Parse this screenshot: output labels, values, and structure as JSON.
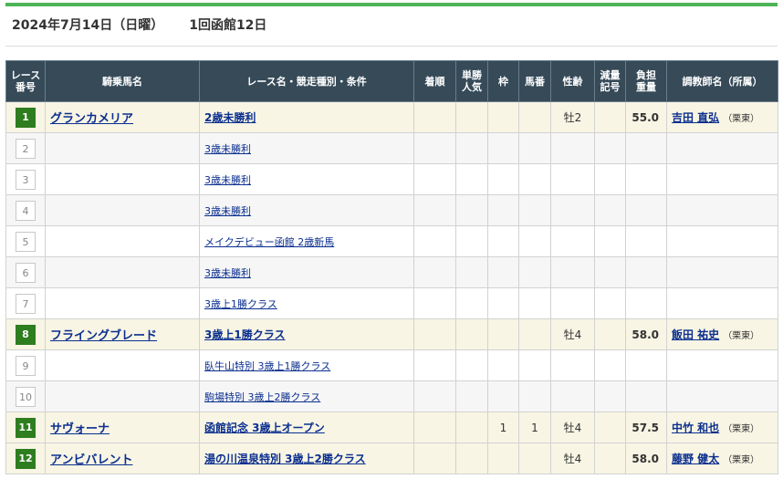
{
  "header": {
    "date": "2024年7月14日（日曜）",
    "meet": "1回函館12日"
  },
  "columns": [
    "レース番号",
    "騎乗馬名",
    "レース名・競走種別・条件",
    "着順",
    "単勝人気",
    "枠",
    "馬番",
    "性齢",
    "減量記号",
    "負担重量",
    "調教師名（所属）"
  ],
  "column_lines": [
    [
      "レース",
      "番号"
    ],
    [
      "騎乗馬名"
    ],
    [
      "レース名・競走種別・条件"
    ],
    [
      "着順"
    ],
    [
      "単勝",
      "人気"
    ],
    [
      "枠"
    ],
    [
      "馬番"
    ],
    [
      "性齢"
    ],
    [
      "減量",
      "記号"
    ],
    [
      "負担",
      "重量"
    ],
    [
      "調教師名（所属）"
    ]
  ],
  "rows": [
    {
      "no": "1",
      "horse": "グランカメリア",
      "race": "2歳未勝利",
      "finish": "",
      "pop": "",
      "waku": "",
      "umaban": "",
      "sexage": "牡2",
      "genryo": "",
      "weight": "55.0",
      "trainer": "吉田 直弘",
      "affil": "（栗東）",
      "ride": true
    },
    {
      "no": "2",
      "horse": "",
      "race": "3歳未勝利",
      "finish": "",
      "pop": "",
      "waku": "",
      "umaban": "",
      "sexage": "",
      "genryo": "",
      "weight": "",
      "trainer": "",
      "affil": "",
      "ride": false
    },
    {
      "no": "3",
      "horse": "",
      "race": "3歳未勝利",
      "finish": "",
      "pop": "",
      "waku": "",
      "umaban": "",
      "sexage": "",
      "genryo": "",
      "weight": "",
      "trainer": "",
      "affil": "",
      "ride": false
    },
    {
      "no": "4",
      "horse": "",
      "race": "3歳未勝利",
      "finish": "",
      "pop": "",
      "waku": "",
      "umaban": "",
      "sexage": "",
      "genryo": "",
      "weight": "",
      "trainer": "",
      "affil": "",
      "ride": false
    },
    {
      "no": "5",
      "horse": "",
      "race": "メイクデビュー函館 2歳新馬",
      "finish": "",
      "pop": "",
      "waku": "",
      "umaban": "",
      "sexage": "",
      "genryo": "",
      "weight": "",
      "trainer": "",
      "affil": "",
      "ride": false
    },
    {
      "no": "6",
      "horse": "",
      "race": "3歳未勝利",
      "finish": "",
      "pop": "",
      "waku": "",
      "umaban": "",
      "sexage": "",
      "genryo": "",
      "weight": "",
      "trainer": "",
      "affil": "",
      "ride": false
    },
    {
      "no": "7",
      "horse": "",
      "race": "3歳上1勝クラス",
      "finish": "",
      "pop": "",
      "waku": "",
      "umaban": "",
      "sexage": "",
      "genryo": "",
      "weight": "",
      "trainer": "",
      "affil": "",
      "ride": false
    },
    {
      "no": "8",
      "horse": "フライングブレード",
      "race": "3歳上1勝クラス",
      "finish": "",
      "pop": "",
      "waku": "",
      "umaban": "",
      "sexage": "牡4",
      "genryo": "",
      "weight": "58.0",
      "trainer": "飯田 祐史",
      "affil": "（栗東）",
      "ride": true
    },
    {
      "no": "9",
      "horse": "",
      "race": "臥牛山特別 3歳上1勝クラス",
      "finish": "",
      "pop": "",
      "waku": "",
      "umaban": "",
      "sexage": "",
      "genryo": "",
      "weight": "",
      "trainer": "",
      "affil": "",
      "ride": false
    },
    {
      "no": "10",
      "horse": "",
      "race": "駒場特別 3歳上2勝クラス",
      "finish": "",
      "pop": "",
      "waku": "",
      "umaban": "",
      "sexage": "",
      "genryo": "",
      "weight": "",
      "trainer": "",
      "affil": "",
      "ride": false
    },
    {
      "no": "11",
      "horse": "サヴォーナ",
      "race": "函館記念 3歳上オープン",
      "finish": "",
      "pop": "",
      "waku": "1",
      "umaban": "1",
      "sexage": "牡4",
      "genryo": "",
      "weight": "57.5",
      "trainer": "中竹 和也",
      "affil": "（栗東）",
      "ride": true
    },
    {
      "no": "12",
      "horse": "アンビバレント",
      "race": "湯の川温泉特別 3歳上2勝クラス",
      "finish": "",
      "pop": "",
      "waku": "",
      "umaban": "",
      "sexage": "牡4",
      "genryo": "",
      "weight": "58.0",
      "trainer": "藤野 健太",
      "affil": "（栗東）",
      "ride": true
    }
  ],
  "colors": {
    "accent": "#4db356",
    "header_bg": "#364a58",
    "highlight_row": "#f8f5e4",
    "race_badge": "#2e7d1f",
    "link": "#0b2f8f"
  }
}
